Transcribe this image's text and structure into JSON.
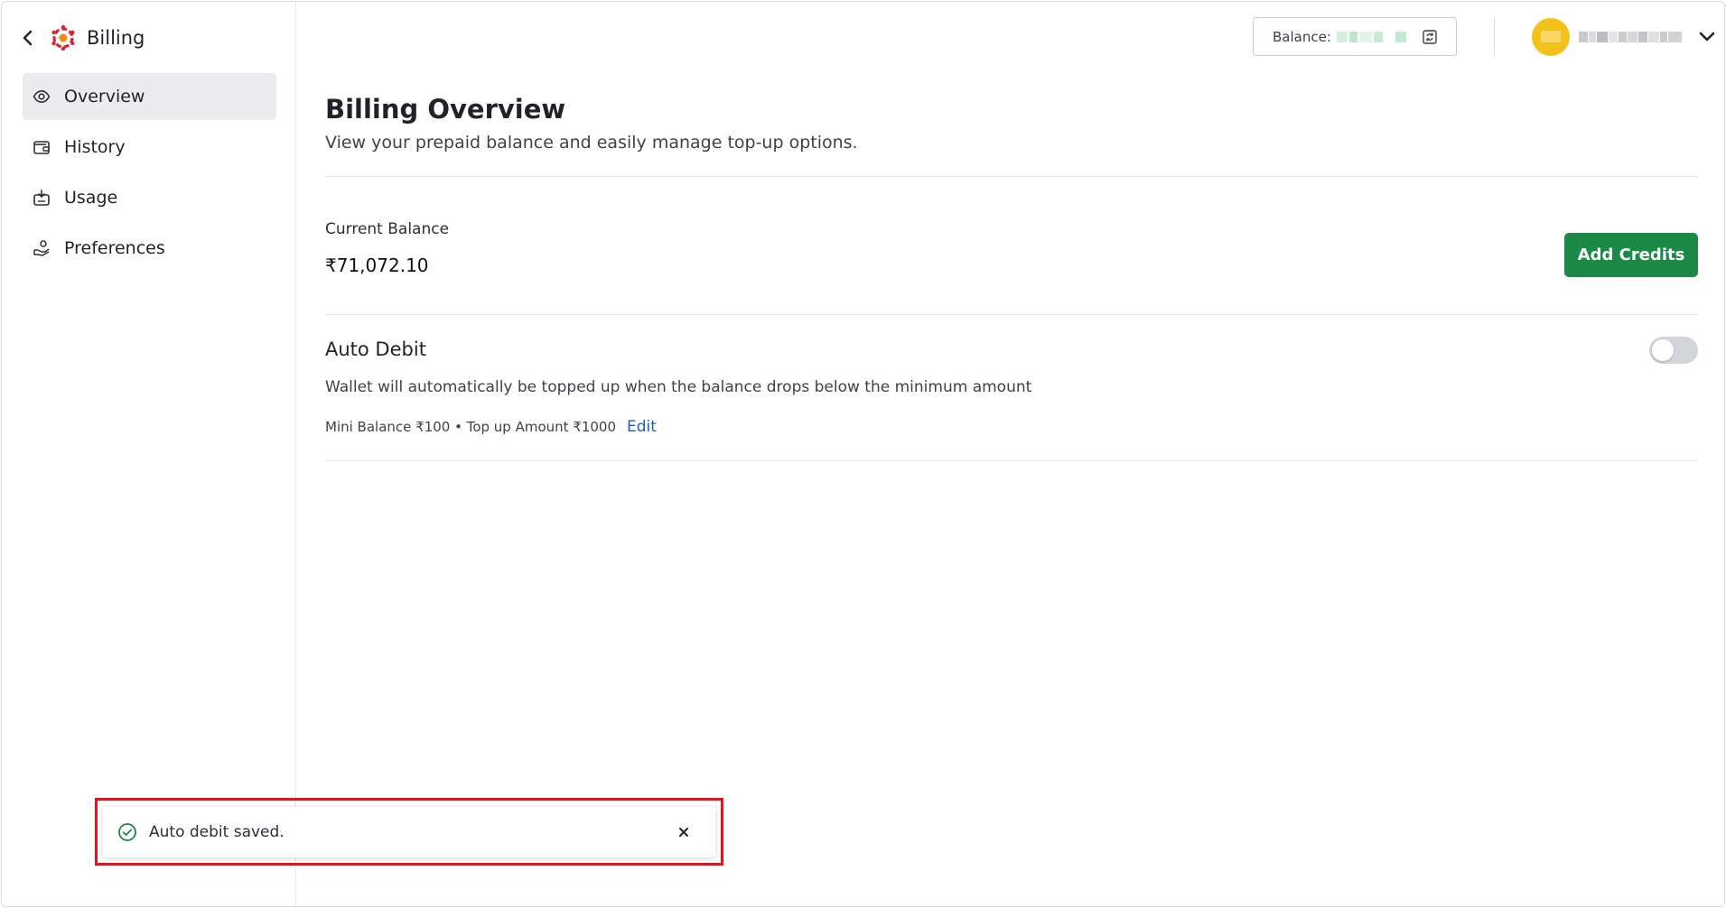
{
  "app": {
    "title": "Billing"
  },
  "sidebar": {
    "items": [
      {
        "label": "Overview",
        "icon": "eye-icon",
        "active": true
      },
      {
        "label": "History",
        "icon": "wallet-icon",
        "active": false
      },
      {
        "label": "Usage",
        "icon": "usage-icon",
        "active": false
      },
      {
        "label": "Preferences",
        "icon": "hand-coins-icon",
        "active": false
      }
    ]
  },
  "header": {
    "balance_label": "Balance:",
    "user_avatar_color": "#f3c21a"
  },
  "page": {
    "title": "Billing Overview",
    "subtitle": "View your prepaid balance and easily manage top-up options."
  },
  "current_balance": {
    "label": "Current Balance",
    "value": "₹71,072.10",
    "add_credits_label": "Add Credits"
  },
  "auto_debit": {
    "title": "Auto Debit",
    "enabled": false,
    "description": "Wallet will automatically be topped up when the balance drops below the minimum amount",
    "meta": "Mini Balance ₹100 • Top up Amount ₹1000",
    "edit_label": "Edit"
  },
  "toast": {
    "message": "Auto debit saved.",
    "icon": "check-circle-icon"
  },
  "colors": {
    "primary_green": "#1c8a46",
    "link_blue": "#1c5fbf",
    "highlight_red": "#e3141b"
  }
}
